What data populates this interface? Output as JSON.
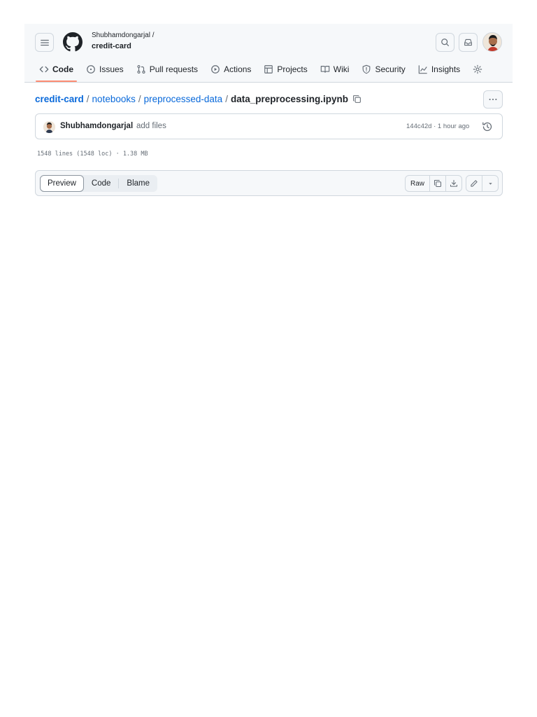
{
  "header": {
    "owner": "Shubhamdongarjal /",
    "repo": "credit-card"
  },
  "nav": [
    {
      "label": "Code",
      "icon": "code-icon",
      "active": true
    },
    {
      "label": "Issues",
      "icon": "issue-icon"
    },
    {
      "label": "Pull requests",
      "icon": "pull-request-icon"
    },
    {
      "label": "Actions",
      "icon": "play-icon"
    },
    {
      "label": "Projects",
      "icon": "table-icon"
    },
    {
      "label": "Wiki",
      "icon": "book-icon"
    },
    {
      "label": "Security",
      "icon": "shield-icon"
    },
    {
      "label": "Insights",
      "icon": "graph-icon"
    }
  ],
  "breadcrumb": {
    "repo": "credit-card",
    "sep": "/",
    "folder1": "notebooks",
    "folder2": "preprocessed-data",
    "file": "data_preprocessing.ipynb"
  },
  "commit": {
    "author": "Shubhamdongarjal",
    "message": "add files",
    "meta": "144c42d · 1 hour ago"
  },
  "file_info": "1548 lines (1548 loc) · 1.38 MB",
  "toolbar": {
    "tabs": [
      "Preview",
      "Code",
      "Blame"
    ],
    "raw_label": "Raw"
  },
  "colors": {
    "accent_link": "#0969da",
    "nav_underline": "#fd8c73",
    "border": "#d0d7de"
  }
}
